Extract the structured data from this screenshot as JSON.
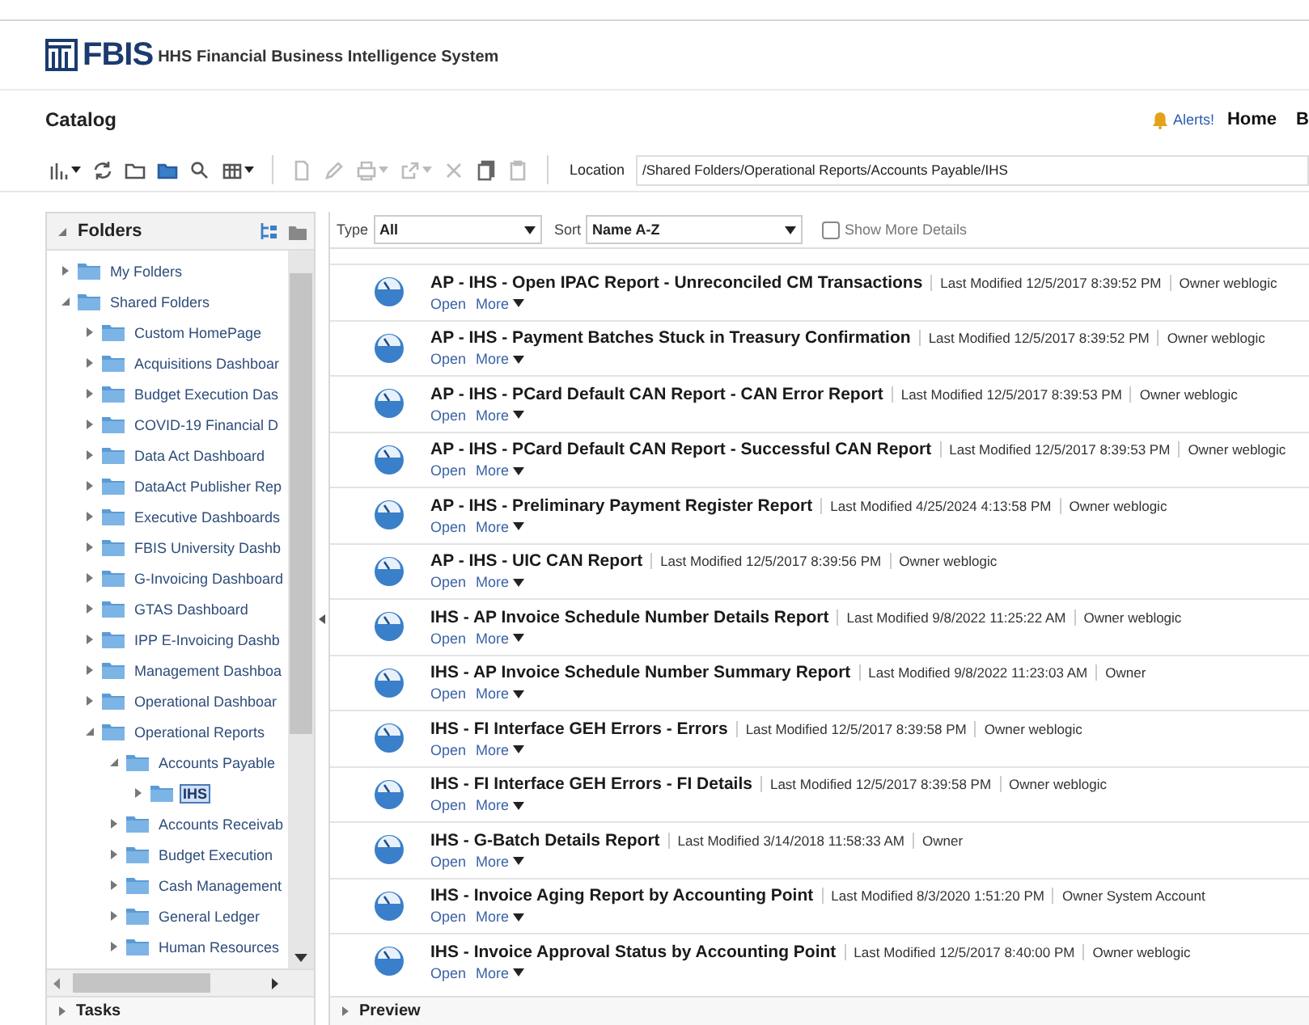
{
  "header": {
    "logo": "FBIS",
    "subtitle": "HHS Financial Business Intelligence System"
  },
  "page_title": "Catalog",
  "global_links": {
    "alerts": "Alerts!",
    "home": "Home",
    "cut_link": "B"
  },
  "toolbar": {
    "location_label": "Location",
    "location": "/Shared Folders/Operational Reports/Accounts Payable/IHS"
  },
  "folders_panel": {
    "title": "Folders",
    "tree": [
      {
        "label": "My Folders",
        "expanded": false,
        "selected": false
      },
      {
        "label": "Shared Folders",
        "expanded": true,
        "selected": false,
        "children": [
          {
            "label": "Custom HomePage",
            "expanded": false,
            "selected": false
          },
          {
            "label": "Acquisitions Dashboar",
            "expanded": false,
            "selected": false
          },
          {
            "label": "Budget Execution Das",
            "expanded": false,
            "selected": false
          },
          {
            "label": "COVID-19 Financial D",
            "expanded": false,
            "selected": false
          },
          {
            "label": "Data Act Dashboard",
            "expanded": false,
            "selected": false
          },
          {
            "label": "DataAct Publisher Rep",
            "expanded": false,
            "selected": false
          },
          {
            "label": "Executive Dashboards",
            "expanded": false,
            "selected": false
          },
          {
            "label": "FBIS University Dashb",
            "expanded": false,
            "selected": false
          },
          {
            "label": "G-Invoicing Dashboard",
            "expanded": false,
            "selected": false
          },
          {
            "label": "GTAS Dashboard",
            "expanded": false,
            "selected": false
          },
          {
            "label": "IPP E-Invoicing Dashb",
            "expanded": false,
            "selected": false
          },
          {
            "label": "Management Dashboa",
            "expanded": false,
            "selected": false
          },
          {
            "label": "Operational Dashboar",
            "expanded": false,
            "selected": false
          },
          {
            "label": "Operational Reports",
            "expanded": true,
            "selected": false,
            "children": [
              {
                "label": "Accounts Payable",
                "expanded": true,
                "selected": false,
                "children": [
                  {
                    "label": "IHS",
                    "expanded": false,
                    "selected": true
                  }
                ]
              },
              {
                "label": "Accounts Receivab",
                "expanded": false,
                "selected": false
              },
              {
                "label": "Budget Execution",
                "expanded": false,
                "selected": false
              },
              {
                "label": "Cash Management",
                "expanded": false,
                "selected": false
              },
              {
                "label": "General Ledger",
                "expanded": false,
                "selected": false
              },
              {
                "label": "Human Resources",
                "expanded": false,
                "selected": false
              }
            ]
          }
        ]
      }
    ]
  },
  "tasks": {
    "title": "Tasks",
    "expanded": false
  },
  "filters": {
    "type_label": "Type",
    "type_value": "All",
    "sort_label": "Sort",
    "sort_value": "Name A-Z",
    "show_more_details": {
      "label": "Show More Details",
      "checked": false
    }
  },
  "items": [
    {
      "title": "AP - IHS - Open IPAC Report - Unreconciled CM Transactions",
      "modified": "Last Modified 12/5/2017 8:39:52 PM",
      "owner": "Owner weblogic",
      "open": "Open",
      "more": "More"
    },
    {
      "title": "AP - IHS - Payment Batches Stuck in Treasury Confirmation",
      "modified": "Last Modified 12/5/2017 8:39:52 PM",
      "owner": "Owner weblogic",
      "open": "Open",
      "more": "More"
    },
    {
      "title": "AP - IHS - PCard Default CAN Report - CAN Error Report",
      "modified": "Last Modified 12/5/2017 8:39:53 PM",
      "owner": "Owner weblogic",
      "open": "Open",
      "more": "More"
    },
    {
      "title": "AP - IHS - PCard Default CAN Report - Successful CAN Report",
      "modified": "Last Modified 12/5/2017 8:39:53 PM",
      "owner": "Owner weblogic",
      "open": "Open",
      "more": "More"
    },
    {
      "title": "AP - IHS - Preliminary Payment Register Report",
      "modified": "Last Modified 4/25/2024 4:13:58 PM",
      "owner": "Owner weblogic",
      "open": "Open",
      "more": "More"
    },
    {
      "title": "AP - IHS - UIC CAN Report",
      "modified": "Last Modified 12/5/2017 8:39:56 PM",
      "owner": "Owner weblogic",
      "open": "Open",
      "more": "More"
    },
    {
      "title": "IHS - AP Invoice Schedule Number Details Report",
      "modified": "Last Modified 9/8/2022 11:25:22 AM",
      "owner": "Owner weblogic",
      "open": "Open",
      "more": "More"
    },
    {
      "title": "IHS - AP Invoice Schedule Number Summary Report",
      "modified": "Last Modified 9/8/2022 11:23:03 AM",
      "owner": "Owner",
      "open": "Open",
      "more": "More"
    },
    {
      "title": "IHS - FI Interface GEH Errors - Errors",
      "modified": "Last Modified 12/5/2017 8:39:58 PM",
      "owner": "Owner weblogic",
      "open": "Open",
      "more": "More"
    },
    {
      "title": "IHS - FI Interface GEH Errors - FI Details",
      "modified": "Last Modified 12/5/2017 8:39:58 PM",
      "owner": "Owner weblogic",
      "open": "Open",
      "more": "More"
    },
    {
      "title": "IHS - G-Batch Details Report",
      "modified": "Last Modified 3/14/2018 11:58:33 AM",
      "owner": "Owner",
      "open": "Open",
      "more": "More"
    },
    {
      "title": "IHS - Invoice Aging Report by Accounting Point",
      "modified": "Last Modified 8/3/2020 1:51:20 PM",
      "owner": "Owner System Account",
      "open": "Open",
      "more": "More"
    },
    {
      "title": "IHS - Invoice Approval Status by Accounting Point",
      "modified": "Last Modified 12/5/2017 8:40:00 PM",
      "owner": "Owner weblogic",
      "open": "Open",
      "more": "More"
    }
  ],
  "preview": {
    "title": "Preview",
    "expanded": false
  }
}
